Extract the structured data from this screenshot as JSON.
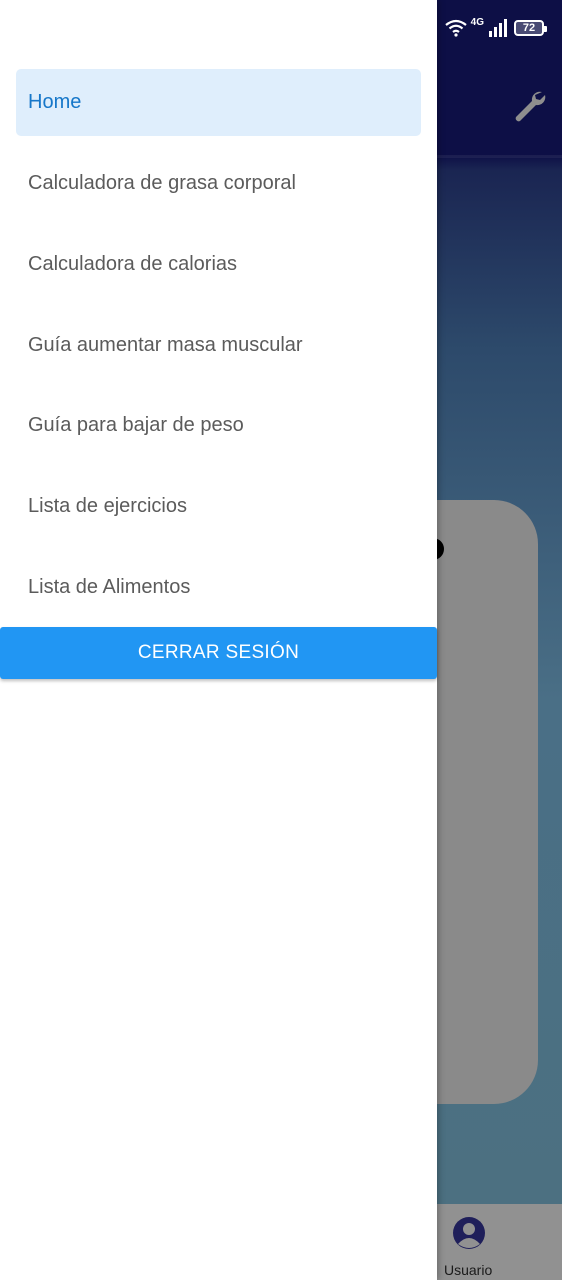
{
  "status_bar": {
    "network": "4G",
    "battery": "72"
  },
  "background": {
    "nav_user_label": "Usuario"
  },
  "drawer": {
    "items": [
      {
        "label": "Home",
        "active": true
      },
      {
        "label": "Calculadora de grasa corporal",
        "active": false
      },
      {
        "label": "Calculadora de calorias",
        "active": false
      },
      {
        "label": "Guía aumentar masa muscular",
        "active": false
      },
      {
        "label": "Guía para bajar de peso",
        "active": false
      },
      {
        "label": "Lista de ejercicios",
        "active": false
      },
      {
        "label": "Lista de Alimentos",
        "active": false
      }
    ],
    "logout_label": "CERRAR SESIÓN"
  },
  "icons": {
    "settings": "wrench-icon",
    "user": "account-circle-icon",
    "wifi": "wifi-icon",
    "signal": "signal-icon",
    "battery": "battery-icon"
  },
  "colors": {
    "header": "#0d0f46",
    "active_item_bg": "#dfeefc",
    "active_item_text": "#1677c9",
    "logout_button": "#2196f3"
  }
}
